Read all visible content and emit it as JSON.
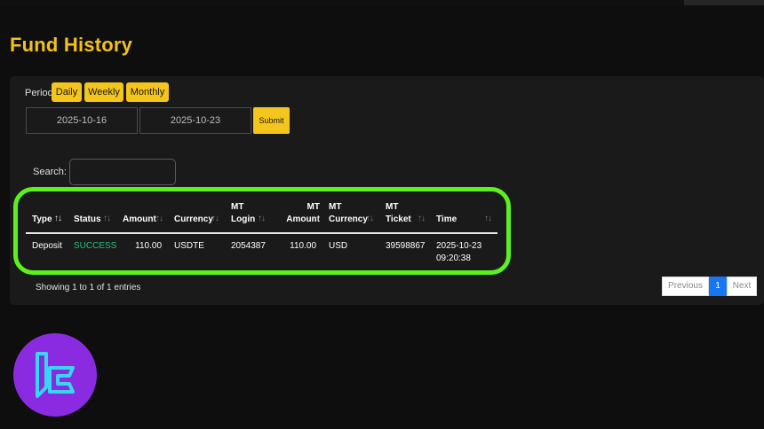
{
  "page": {
    "title": "Fund History"
  },
  "filters": {
    "period_label": "Period",
    "periods": [
      "Daily",
      "Weekly",
      "Monthly"
    ],
    "date_from": "2025-10-16",
    "date_to": "2025-10-23",
    "submit_label": "Submit",
    "search_label": "Search:",
    "search_value": ""
  },
  "table": {
    "columns": [
      {
        "label": "Type",
        "sort": "asc"
      },
      {
        "label": "Status",
        "sort": "none"
      },
      {
        "label": "Amount",
        "sort": "none"
      },
      {
        "label": "Currency",
        "sort": "none"
      },
      {
        "label": "MT Login",
        "sort": "none"
      },
      {
        "label": "MT Amount",
        "sort": "none"
      },
      {
        "label": "MT Currency",
        "sort": "none"
      },
      {
        "label": "MT Ticket",
        "sort": "none"
      },
      {
        "label": "Time",
        "sort": "none"
      }
    ],
    "rows": [
      {
        "type": "Deposit",
        "status": "SUCCESS",
        "amount": "110.00",
        "currency": "USDTE",
        "mt_login": "2054387",
        "mt_amount": "110.00",
        "mt_currency": "USD",
        "mt_ticket": "39598867",
        "time": "2025-10-23 09:20:38"
      }
    ],
    "info": "Showing 1 to 1 of 1 entries"
  },
  "pagination": {
    "previous": "Previous",
    "current": "1",
    "next": "Next"
  },
  "colors": {
    "accent": "#f4c51c",
    "success": "#2bbf7a",
    "highlight": "#5cf01c",
    "page_active": "#1976f2",
    "logo_bg": "#8a2be2"
  },
  "icons": {
    "sort_asc": "sort-asc-icon",
    "sort_none": "sort-icon",
    "logo": "brand-logo-icon"
  }
}
